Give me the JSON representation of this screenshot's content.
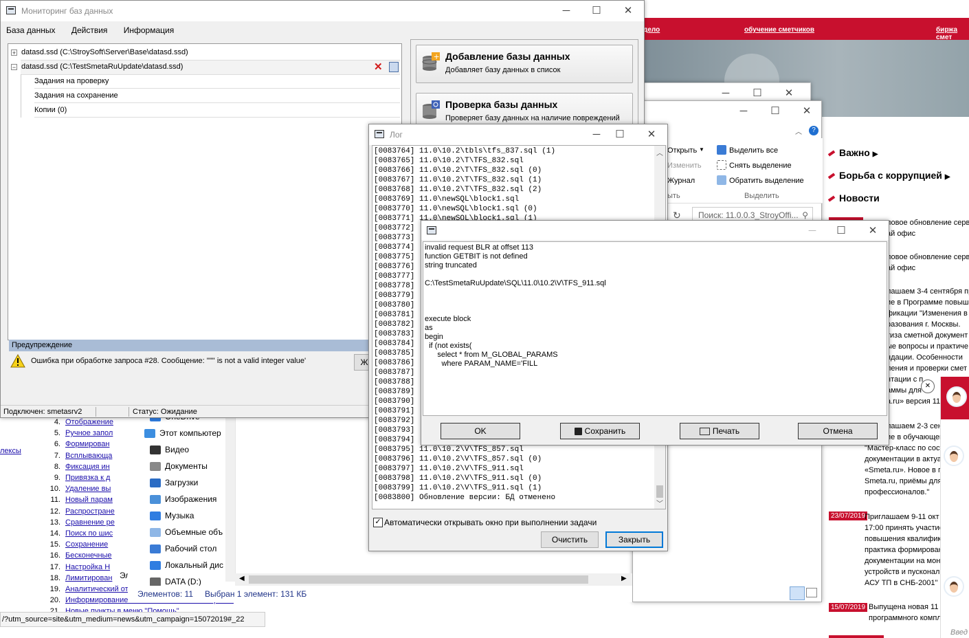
{
  "website": {
    "top_links": [
      "дело",
      "обучение сметчиков",
      "биржа смет"
    ],
    "sections": [
      "Важно",
      "Борьба с коррупцией",
      "Новости"
    ],
    "news_lines": [
      "ловое обновление сервис",
      "ай офис",
      "ловое обновление сервис",
      "ай офис",
      "лашаем 3-4 сентября пр",
      "ие в Программе повышен",
      "фикации \"Изменения в с",
      "разования г. Москвы.",
      "тиза сметной документ",
      "ые вопросы и практиче",
      "ндации. Особенности",
      "ления и проверки смет",
      "нтации с п",
      "аммы для ",
      "a.ru» версия 11»",
      "лашаем 2-3 сентя",
      "ие в обучающем",
      "\"Мастер-класс по сост",
      "документации в актуа",
      "«Smeta.ru». Новое в п",
      "Smeta.ru, приёмы для",
      "профессионалов.\""
    ],
    "news2": {
      "date": "23/07/2019",
      "lines": [
        "Приглашаем 9-11 окт",
        "17:00 принять участие",
        "повышения квалифик",
        "практика формирован",
        "документации на монт",
        "устройств и пусконал",
        "АСУ ТП в СНБ-2001\""
      ]
    },
    "news3": {
      "date": "15/07/2019",
      "lines": [
        "Выпущена новая 11 в",
        "программного компле"
      ]
    },
    "chat_close": "✕",
    "bottom_right_text": "Введ"
  },
  "left_page": {
    "side_link": "лексы",
    "items": [
      {
        "n": "4.",
        "label": "Отображение"
      },
      {
        "n": "5.",
        "label": "Ручное запол"
      },
      {
        "n": "6.",
        "label": "Формирован"
      },
      {
        "n": "7.",
        "label": "Всплывающа"
      },
      {
        "n": "8.",
        "label": "Фиксация ин"
      },
      {
        "n": "9.",
        "label": "Привязка к д"
      },
      {
        "n": "10.",
        "label": "Удаление вы"
      },
      {
        "n": "11.",
        "label": "Новый парам"
      },
      {
        "n": "12.",
        "label": "Распростране"
      },
      {
        "n": "13.",
        "label": "Сравнение ре"
      },
      {
        "n": "14.",
        "label": "Поиск по шис"
      },
      {
        "n": "15.",
        "label": "Сохранение"
      },
      {
        "n": "16.",
        "label": "Бесконечные"
      },
      {
        "n": "17.",
        "label": "Настройка Н"
      },
      {
        "n": "18.",
        "label": "Лимитирован"
      },
      {
        "n": "19.",
        "label": "Аналитический от"
      },
      {
        "n": "20.",
        "label": "Информирование о поставке новых блокировок"
      },
      {
        "n": "21.",
        "label": "Новые пункты в меню \"Помощь\""
      }
    ],
    "url_status": "/?utm_source=site&utm_medium=news&utm_campaign=15072019#_22",
    "partial": "Эл"
  },
  "explorer": {
    "ribbon": [
      "Открыть",
      "Изменить",
      "Журнал",
      "Выделить все",
      "Снять выделение",
      "Обратить выделение"
    ],
    "ribbon_group_label": "Выделить",
    "ribbon_group_label2": "ыть",
    "search_placeholder": "Поиск: 11.0.0.3_StroyOffi...",
    "nav": [
      "OneDrive",
      "Этот компьютер",
      "Видео",
      "Документы",
      "Загрузки",
      "Изображения",
      "Музыка",
      "Объемные объ",
      "Рабочий стол",
      "Локальный дис",
      "DATA (D:)"
    ],
    "status_items": "Элементов: 11",
    "status_selected": "Выбран 1 элемент: 131 КБ"
  },
  "monitor": {
    "title": "Мониторинг баз данных",
    "menu": [
      "База данных",
      "Действия",
      "Информация"
    ],
    "tree": [
      {
        "label": "datasd.ssd (C:\\StroySoft\\Server\\Base\\datasd.ssd)",
        "exp": "+"
      },
      {
        "label": "datasd.ssd (C:\\TestSmetaRuUpdate\\datasd.ssd)",
        "exp": "−"
      },
      {
        "label": "Задания на проверку"
      },
      {
        "label": "Задания на сохранение"
      },
      {
        "label": "Копии (0)"
      }
    ],
    "actions": [
      {
        "title": "Добавление базы данных",
        "desc": "Добавляет базу данных в список"
      },
      {
        "title": "Проверка базы данных",
        "desc": "Проверяет базу данных на наличие повреждений"
      }
    ],
    "warning_header": "Предупреждение",
    "warning_text": "Ошибка при обработке запроса #28. Сообщение: '\"\"' is not a valid integer value'",
    "warning_btn": "Ж",
    "status_connected": "Подключен: smetasrv2",
    "status_state": "Статус: Ожидание"
  },
  "log": {
    "title": "Лог",
    "lines": [
      "[0083764] 11.0\\10.2\\tbls\\tfs_837.sql (1)",
      "[0083765] 11.0\\10.2\\T\\TFS_832.sql",
      "[0083766] 11.0\\10.2\\T\\TFS_832.sql (0)",
      "[0083767] 11.0\\10.2\\T\\TFS_832.sql (1)",
      "[0083768] 11.0\\10.2\\T\\TFS_832.sql (2)",
      "[0083769] 11.0\\newSQL\\block1.sql",
      "[0083770] 11.0\\newSQL\\block1.sql (0)",
      "[0083771] 11.0\\newSQL\\block1.sql (1)",
      "[0083772]",
      "[0083773]",
      "[0083774]",
      "[0083775]",
      "[0083776]",
      "[0083777]",
      "[0083778]",
      "[0083779]",
      "[0083780]",
      "[0083781]",
      "[0083782]",
      "[0083783]",
      "[0083784]",
      "[0083785]",
      "[0083786]",
      "[0083787]",
      "[0083788]",
      "[0083789]",
      "[0083790]",
      "[0083791]",
      "[0083792]",
      "[0083793]",
      "[0083794]",
      "[0083795] 11.0\\10.2\\V\\TFS_857.sql",
      "[0083796] 11.0\\10.2\\V\\TFS_857.sql (0)",
      "[0083797] 11.0\\10.2\\V\\TFS_911.sql",
      "[0083798] 11.0\\10.2\\V\\TFS_911.sql (0)",
      "[0083799] 11.0\\10.2\\V\\TFS_911.sql (1)",
      "[0083800] Обновление версии: БД отменено"
    ],
    "auto_open_label": "Автоматически открывать окно при  выполнении задачи",
    "clear_btn": "Очистить",
    "close_btn": "Закрыть"
  },
  "error": {
    "lines": [
      "invalid request BLR at offset 113",
      "function GETBIT is not defined",
      "string truncated",
      "",
      "C:\\TestSmetaRuUpdate\\SQL\\11.0\\10.2\\V\\TFS_911.sql",
      "",
      "",
      "",
      "execute block",
      "as",
      "begin",
      "  if (not exists(",
      "      select * from M_GLOBAL_PARAMS",
      "        where PARAM_NAME='FILL"
    ],
    "ok_btn": "OK",
    "save_btn": "Сохранить",
    "print_btn": "Печать",
    "cancel_btn": "Отмена"
  },
  "colors": {
    "site_red": "#c8102e",
    "selection_blue": "#0078d7",
    "warning_header_bg": "#a9bcd6"
  }
}
